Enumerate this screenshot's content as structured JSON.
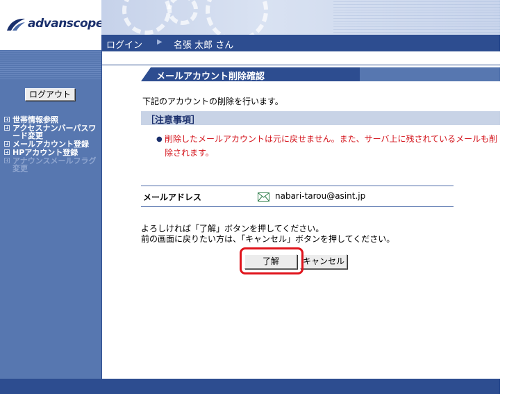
{
  "brand": {
    "name": "advanscope"
  },
  "nav": {
    "login_label": "ログイン",
    "user_name": "名張 太郎 さん"
  },
  "sidebar": {
    "logout_label": "ログアウト",
    "items": [
      {
        "label": "世帯情報参照",
        "enabled": true
      },
      {
        "label": "アクセスナンバーパスワード変更",
        "enabled": true
      },
      {
        "label": "メールアカウント登録",
        "enabled": true
      },
      {
        "label": "HPアカウント登録",
        "enabled": true
      },
      {
        "label": "アナウンスメールフラグ変更",
        "enabled": false
      }
    ]
  },
  "main": {
    "title": "メールアカウント削除確認",
    "intro": "下記のアカウントの削除を行います。",
    "notice_title": "［注意事項］",
    "warning": "削除したメールアカウントは元に戻せません。また、サーバ上に残されているメールも削除されます。",
    "email_label": "メールアドレス",
    "email_value": "nabari-tarou@asint.jp",
    "confirm_line1": "よろしければ「了解」ボタンを押してください。",
    "confirm_line2": "前の画面に戻りたい方は、「キャンセル」ボタンを押してください。",
    "ok_label": "了解",
    "cancel_label": "キャンセル"
  },
  "colors": {
    "nav_dark": "#2d4d90",
    "sidebar": "#5777b0",
    "notice_bg": "#c8d3e6",
    "warning_text": "#d4141c",
    "highlight": "#e0141c"
  }
}
